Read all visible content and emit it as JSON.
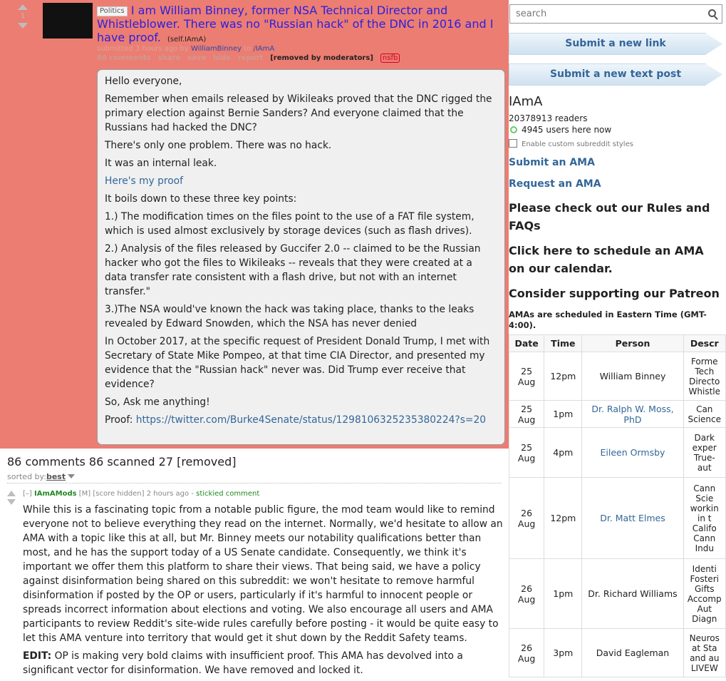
{
  "post": {
    "score": "1",
    "flair": "Politics",
    "title": "I am William Binney, former NSA Technical Director and Whistleblower. There was no \"Russian hack\" of the DNC in 2016 and I have proof.",
    "domain": "(self.IAmA)",
    "tagline": {
      "prefix": "submitted 3 hours ago by",
      "author": "WilliamBinney",
      "to": "to",
      "subreddit": "/IAmA"
    },
    "buttons": [
      "86 comments",
      "share",
      "save",
      "hide",
      "report"
    ],
    "removed_label": "[removed by moderators]",
    "nsfb_label": "nsfb",
    "body": [
      "Hello everyone,",
      "Remember when emails released by Wikileaks proved that the DNC rigged the primary election against Bernie Sanders? And everyone claimed that the Russians had hacked the DNC?",
      "There's only one problem. There was no hack.",
      "It was an internal leak.",
      "Here's my proof",
      "It boils down to these three key points:",
      "1.) The modification times on the files point to the use of a FAT file system, which is used almost exclusively by storage devices (such as flash drives).",
      "2.) Analysis of the files released by Guccifer 2.0 -- claimed to be the Russian hacker who got the files to Wikileaks -- reveals that they were created at a data transfer rate consistent with a flash drive, but not with an internet transfer.\"",
      "3.)The NSA would've known the hack was taking place, thanks to the leaks revealed by Edward Snowden, which the NSA has never denied",
      "In October 2017, at the specific request of President Donald Trump, I met with Secretary of State Mike Pompeo, at that time CIA Director, and presented my evidence that the \"Russian hack\" never was. Did Trump ever receive that evidence?",
      "So, Ask me anything!"
    ],
    "proof_label": "Proof:",
    "proof_url": "https://twitter.com/Burke4Senate/status/1298106325235380224?s=20"
  },
  "comments_header": "86 comments 86 scanned 27 [removed]",
  "sort": {
    "label": "sorted by:",
    "value": "best"
  },
  "comment": {
    "collapse": "[–]",
    "author": "IAmAMods",
    "mod_tag": "[M]",
    "score": "[score hidden]",
    "time": "2 hours ago",
    "sep": "-",
    "stickied": "stickied comment",
    "body": "While this is a fascinating topic from a notable public figure, the mod team would like to remind everyone not to believe everything they read on the internet. Normally, we'd hesitate to allow an AMA with a topic like this at all, but Mr. Binney meets our notability qualifications better than most, and he has the support today of a US Senate candidate. Consequently, we think it's important we offer them this platform to share their views. That being said, we have a policy against disinformation being shared on this subreddit: we won't hesitate to remove harmful disinformation if posted by the OP or users, particularly if it's harmful to innocent people or spreads incorrect information about elections and voting. We also encourage all users and AMA participants to review Reddit's site-wide rules carefully before posting - it would be quite easy to let this AMA venture into territory that would get it shut down by the Reddit Safety teams.",
    "edit_label": "EDIT:",
    "edit_text": "OP is making very bold claims with insufficient proof. This AMA has devolved into a significant vector for disinformation. We have removed and locked it."
  },
  "sidebar": {
    "search_placeholder": "search",
    "submit_link": "Submit a new link",
    "submit_text": "Submit a new text post",
    "subreddit": "IAmA",
    "readers": "20378913 readers",
    "online": "4945 users here now",
    "custom_styles": "Enable custom subreddit styles",
    "submit_ama": "Submit an AMA",
    "request_ama": "Request an AMA",
    "rules_pre": "Please check out our ",
    "rules_bold": "Rules and FAQs",
    "cal_bold": "Click here",
    "cal_post": " to schedule an AMA on our calendar.",
    "patreon_pre": "Consider supporting our ",
    "patreon_bold": "Patreon",
    "timezone": "AMAs are scheduled in Eastern Time (GMT-4:00).",
    "table_headers": [
      "Date",
      "Time",
      "Person",
      "Descr"
    ],
    "rows": [
      {
        "day": "25",
        "mon": "Aug",
        "time": "12pm",
        "person": "William Binney",
        "link": false,
        "desc": [
          "Forme",
          "Tech",
          "Directo",
          "Whistle"
        ]
      },
      {
        "day": "25",
        "mon": "Aug",
        "time": "1pm",
        "person": "Dr. Ralph W. Moss, PhD",
        "link": true,
        "desc": [
          "Can",
          "Science"
        ]
      },
      {
        "day": "25",
        "mon": "Aug",
        "time": "4pm",
        "person": "Eileen Ormsby",
        "link": true,
        "desc": [
          "Dark",
          "exper",
          "True-",
          "aut"
        ]
      },
      {
        "day": "26",
        "mon": "Aug",
        "time": "12pm",
        "person": "Dr. Matt Elmes",
        "link": true,
        "desc": [
          "Cann",
          "Scie",
          "workin",
          "in t",
          "Califo",
          "Cann",
          "Indu"
        ]
      },
      {
        "day": "26",
        "mon": "Aug",
        "time": "1pm",
        "person": "Dr. Richard Williams",
        "link": false,
        "desc": [
          "Identi",
          "Fosteri",
          "Gifts",
          "Accomp",
          "Aut",
          "Diagn"
        ]
      },
      {
        "day": "26",
        "mon": "Aug",
        "time": "3pm",
        "person": "David Eagleman",
        "link": false,
        "desc": [
          "Neuros",
          "at Sta",
          "and au",
          "LIVEW"
        ]
      }
    ]
  },
  "colors": {
    "post_bg": "#ec7d72",
    "link": "#336699",
    "title": "#2a1fe0",
    "mod": "#228822"
  }
}
